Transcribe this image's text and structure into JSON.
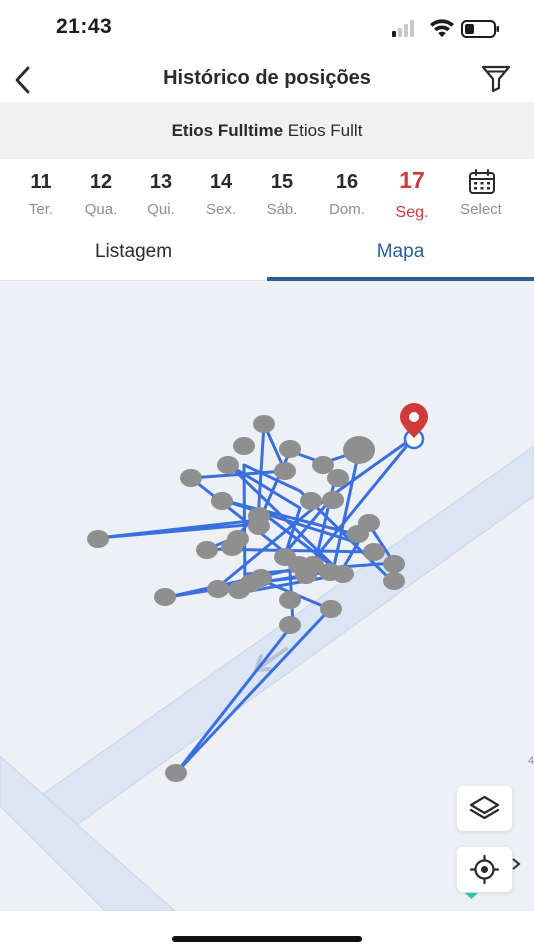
{
  "status_bar": {
    "time": "21:43"
  },
  "nav": {
    "title": "Histórico de posições",
    "back_icon": "chevron-left-icon",
    "filter_icon": "filter-icon"
  },
  "vehicle": {
    "name_bold": "Etios Fulltime",
    "name_regular": "Etios Fullt"
  },
  "days": [
    {
      "num": "11",
      "name": "Ter.",
      "active": false
    },
    {
      "num": "12",
      "name": "Qua.",
      "active": false
    },
    {
      "num": "13",
      "name": "Qui.",
      "active": false
    },
    {
      "num": "14",
      "name": "Sex.",
      "active": false
    },
    {
      "num": "15",
      "name": "Sáb.",
      "active": false
    },
    {
      "num": "16",
      "name": "Dom.",
      "active": false
    },
    {
      "num": "17",
      "name": "Seg.",
      "active": true
    }
  ],
  "select": {
    "label": "Select",
    "icon": "calendar-icon"
  },
  "tabs": {
    "list_label": "Listagem",
    "map_label": "Mapa",
    "active": "Mapa"
  },
  "map": {
    "edge_label": "4",
    "layers_icon": "layers-icon",
    "locate_icon": "crosshair-icon",
    "marker_icon": "map-pin-icon",
    "direction_icon": "arrow-down-left-icon"
  },
  "colors": {
    "accent": "#2b5d99",
    "active_day": "#cf3b3b",
    "route": "#3a6fe0",
    "point": "#8f8f8f",
    "marker": "#d23a3a",
    "road": "#dbe5f3",
    "map_bg": "#edf0f5"
  }
}
